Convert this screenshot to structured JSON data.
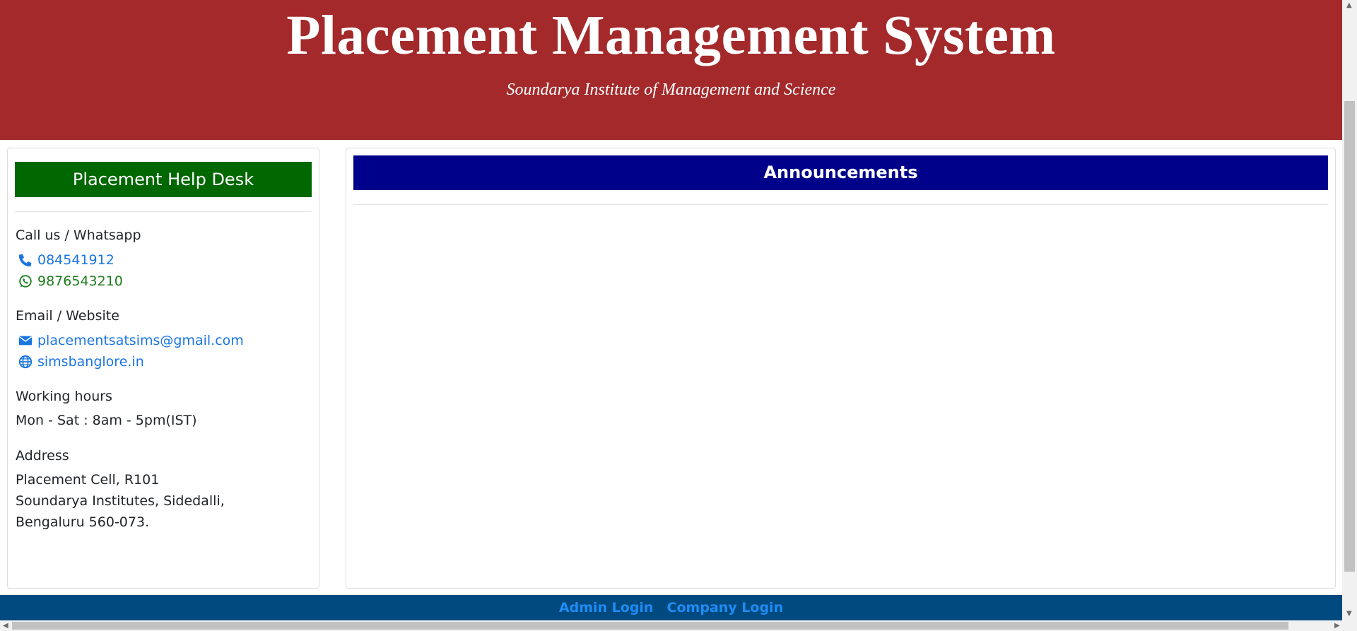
{
  "header": {
    "title": "Placement Management System",
    "subtitle": "Soundarya Institute of Management and Science"
  },
  "helpdesk": {
    "title": "Placement Help Desk",
    "call_heading": "Call us / Whatsapp",
    "phone": "084541912",
    "whatsapp": "9876543210",
    "email_heading": "Email / Website",
    "email": "placementsatsims@gmail.com",
    "website": "simsbanglore.in",
    "hours_heading": "Working hours",
    "hours": "Mon - Sat : 8am - 5pm(IST)",
    "address_heading": "Address",
    "address_lines": [
      "Placement Cell, R101",
      "Soundarya Institutes, Sidedalli,",
      "Bengaluru 560-073."
    ]
  },
  "announcements": {
    "title": "Announcements"
  },
  "footer": {
    "admin_login": "Admin Login",
    "company_login": "Company Login"
  },
  "icons": {
    "phone": "phone-icon",
    "whatsapp": "whatsapp-icon",
    "email": "envelope-icon",
    "website": "globe-icon"
  },
  "colors": {
    "header_bg": "#a3292b",
    "helpdesk_bg": "#016701",
    "announcements_bg": "#00018a",
    "footer_bg": "#004a7f",
    "link": "#1a75e0"
  }
}
